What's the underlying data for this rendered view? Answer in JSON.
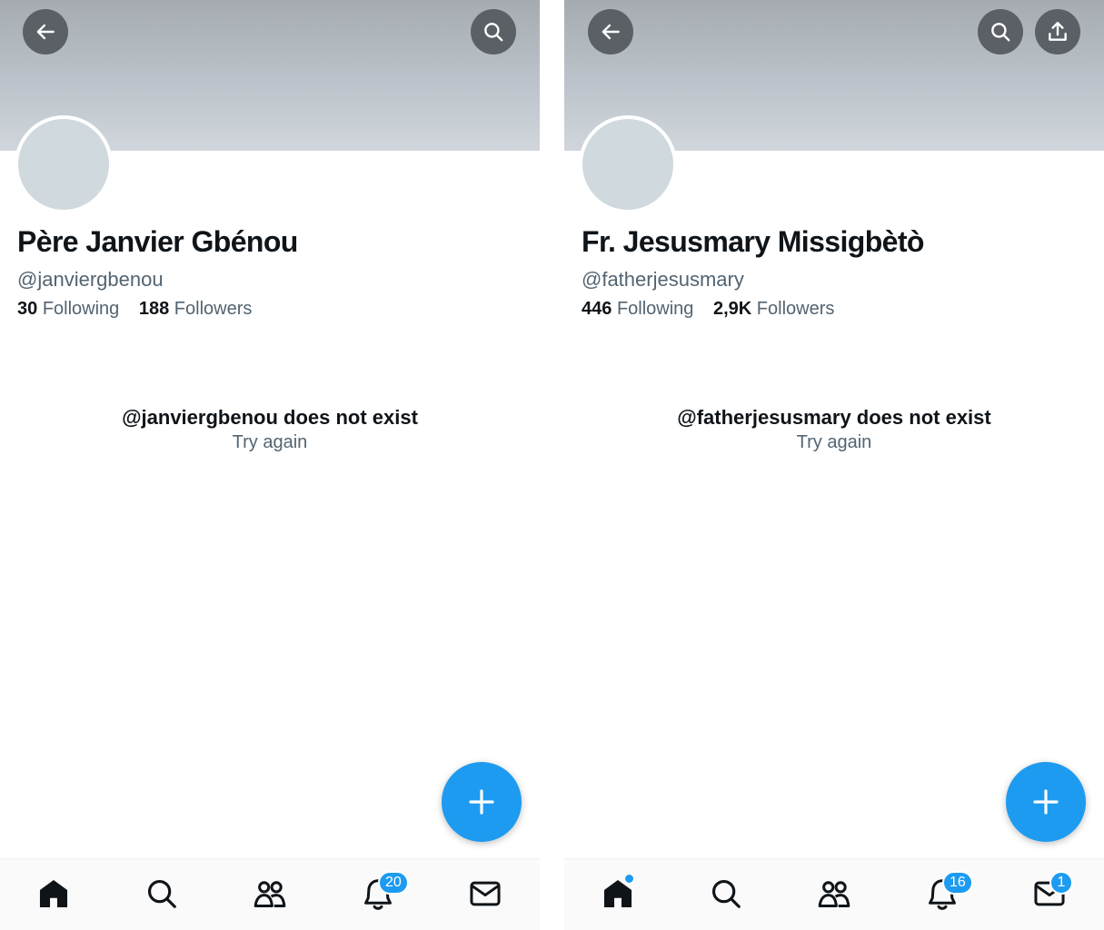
{
  "theme": {
    "accent": "#1d9bf0",
    "text_primary": "#0f1419",
    "text_secondary": "#536471",
    "banner_color": "#bcc3ca",
    "avatar_color": "#cfd9de"
  },
  "left_profile": {
    "header_buttons": [
      "back-arrow-icon",
      "search-icon"
    ],
    "display_name": "Père Janvier Gbénou",
    "handle": "@janviergbenou",
    "following_count": "30",
    "following_label": "Following",
    "followers_count": "188",
    "followers_label": "Followers",
    "error_title": "@janviergbenou does not exist",
    "retry_label": "Try again",
    "fab_icon": "plus-icon",
    "nav": {
      "items": [
        "home-icon",
        "search-icon",
        "communities-icon",
        "bell-icon",
        "mail-icon"
      ],
      "notifications_badge": "20"
    }
  },
  "right_profile": {
    "header_buttons": [
      "back-arrow-icon",
      "search-icon",
      "share-icon"
    ],
    "display_name": "Fr. Jesusmary Missigbètò",
    "handle": "@fatherjesusmary",
    "following_count": "446",
    "following_label": "Following",
    "followers_count": "2,9K",
    "followers_label": "Followers",
    "error_title": "@fatherjesusmary does not exist",
    "retry_label": "Try again",
    "fab_icon": "plus-icon",
    "nav": {
      "items": [
        "home-icon",
        "search-icon",
        "communities-icon",
        "bell-icon",
        "mail-icon"
      ],
      "notifications_badge": "16",
      "messages_badge": "1",
      "home_unread_dot": true
    }
  }
}
